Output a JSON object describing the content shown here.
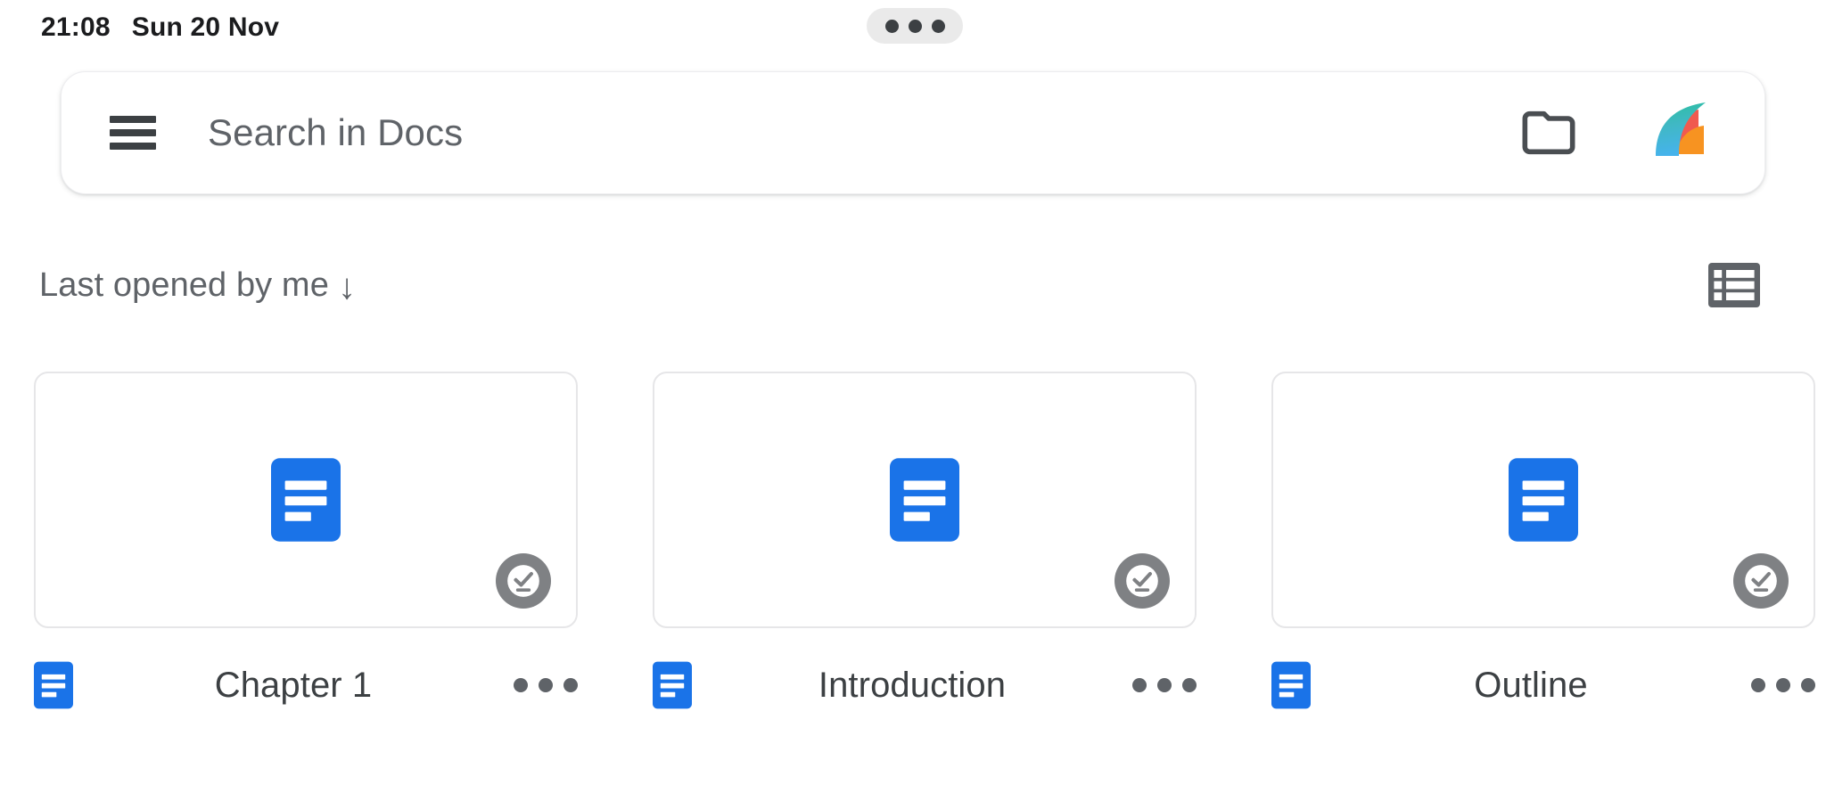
{
  "status_bar": {
    "clock": "21:08",
    "date": "Sun 20 Nov",
    "pill_icon": "three-dots-pill"
  },
  "search": {
    "placeholder": "Search in Docs",
    "value": "",
    "menu_icon": "hamburger-menu-icon",
    "folder_icon": "folder-icon",
    "avatar_icon": "account-avatar"
  },
  "toolbar": {
    "sort_label": "Last opened by me",
    "sort_arrow": "↓",
    "view_toggle_icon": "list-view-icon"
  },
  "colors": {
    "docs_blue": "#1a73e8",
    "text_primary": "#3c4043",
    "text_secondary": "#5f6368",
    "card_border": "#e6e6e8",
    "badge_gray": "#7f8184",
    "pill_gray": "#eaeaea"
  },
  "documents": [
    {
      "name": "Chapter 1",
      "type_icon": "google-docs-icon",
      "offline_badge": "available-offline-icon",
      "overflow_icon": "more-options-icon"
    },
    {
      "name": "Introduction",
      "type_icon": "google-docs-icon",
      "offline_badge": "available-offline-icon",
      "overflow_icon": "more-options-icon"
    },
    {
      "name": "Outline",
      "type_icon": "google-docs-icon",
      "offline_badge": "available-offline-icon",
      "overflow_icon": "more-options-icon"
    }
  ]
}
